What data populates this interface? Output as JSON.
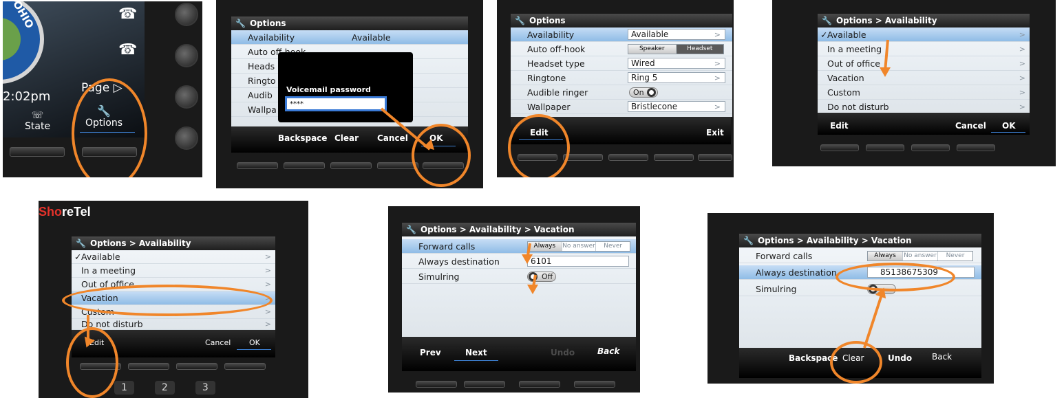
{
  "colors": {
    "annotation": "#f0862a",
    "selection": "#8fbce6",
    "softkey_underline": "#3d7fd1"
  },
  "panel1": {
    "seal_text": "OHIO",
    "time": "2:02pm",
    "page_label": "Page",
    "state_label": "State",
    "options_label": "Options",
    "phone_icon": "phone-icon"
  },
  "panel2": {
    "title": "Options",
    "rows": [
      "Availability",
      "Auto off-hook",
      "Heads",
      "Ringto",
      "Audib",
      "Wallpa"
    ],
    "availability_value": "Available",
    "popup_title": "Voicemail password",
    "password_mask": "****",
    "softkeys": [
      "Backspace",
      "Clear",
      "Cancel",
      "OK"
    ]
  },
  "panel3": {
    "title": "Options",
    "rows": [
      {
        "label": "Availability",
        "value": "Available"
      },
      {
        "label": "Auto off-hook",
        "value": ""
      },
      {
        "label": "Headset type",
        "value": "Wired"
      },
      {
        "label": "Ringtone",
        "value": "Ring 5"
      },
      {
        "label": "Audible ringer",
        "value": "On"
      },
      {
        "label": "Wallpaper",
        "value": "Bristlecone"
      }
    ],
    "offhook_options": [
      "Speaker",
      "Headset"
    ],
    "softkeys": [
      "Edit",
      "Exit"
    ]
  },
  "panel4": {
    "title": "Options > Availability",
    "items": [
      "Available",
      "In a meeting",
      "Out of office",
      "Vacation",
      "Custom",
      "Do not disturb"
    ],
    "checkmark": "✓",
    "softkeys": [
      "Edit",
      "Cancel",
      "OK"
    ]
  },
  "panel5": {
    "logo_so": "Sho",
    "logo_rest": "reTel",
    "title": "Options > Availability",
    "items": [
      "Available",
      "In a meeting",
      "Out of office",
      "Vacation",
      "Custom",
      "Do not disturb"
    ],
    "checkmark": "✓",
    "softkeys": [
      "Edit",
      "Cancel",
      "OK"
    ],
    "keypad": [
      "1",
      "2",
      "3"
    ]
  },
  "panel6": {
    "title": "Options > Availability > Vacation",
    "forward_label": "Forward calls",
    "forward_options": [
      "Always",
      "No answer",
      "Never"
    ],
    "dest_label": "Always destination",
    "dest_value": "6101",
    "simulring_label": "Simulring",
    "simulring_value": "Off",
    "softkeys": [
      "Prev",
      "Next",
      "Undo",
      "Back"
    ]
  },
  "panel7": {
    "title": "Options > Availability > Vacation",
    "forward_label": "Forward calls",
    "forward_options": [
      "Always",
      "No answer",
      "Never"
    ],
    "dest_label": "Always destination",
    "dest_value": "85138675309",
    "simulring_label": "Simulring",
    "softkeys": [
      "Backspace",
      "Clear",
      "Undo",
      "Back"
    ]
  }
}
